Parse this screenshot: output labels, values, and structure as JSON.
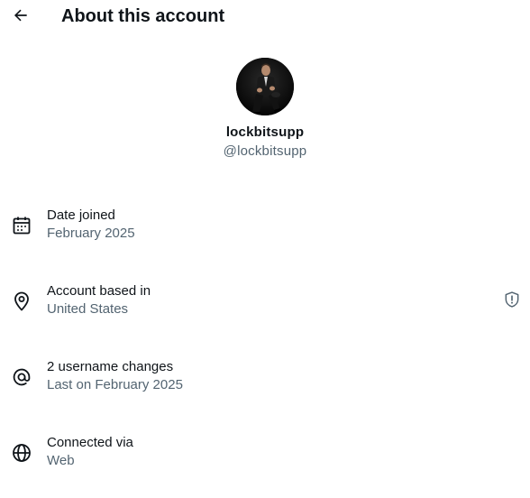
{
  "header": {
    "title": "About this account",
    "back_icon": "arrow-left-icon"
  },
  "profile": {
    "display_name": "lockbitsupp",
    "handle": "@lockbitsupp"
  },
  "details": {
    "joined": {
      "icon": "calendar-icon",
      "label": "Date joined",
      "value": "February 2025"
    },
    "location": {
      "icon": "location-pin-icon",
      "label": "Account based in",
      "value": "United States",
      "badge_icon": "shield-alert-icon"
    },
    "username": {
      "icon": "at-sign-icon",
      "label": "2 username changes",
      "value": "Last on February 2025"
    },
    "connected": {
      "icon": "globe-icon",
      "label": "Connected via",
      "value": "Web"
    }
  },
  "colors": {
    "primary_text": "#0f1419",
    "secondary_text": "#536471",
    "background": "#ffffff"
  }
}
